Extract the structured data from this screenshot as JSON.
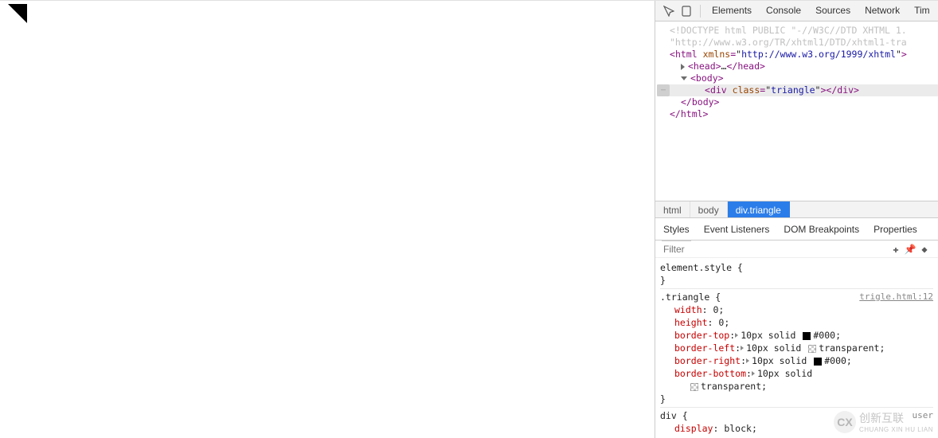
{
  "devtools": {
    "tabs": [
      "Elements",
      "Console",
      "Sources",
      "Network",
      "Tim"
    ],
    "activeTab": 0
  },
  "domTree": {
    "doctype": "<!DOCTYPE html PUBLIC \"-//W3C//DTD XHTML 1.",
    "doctypeUrl": "\"http://www.w3.org/TR/xhtml1/DTD/xhtml1-tra",
    "html": {
      "tag": "html",
      "attrName": "xmlns",
      "attrValue": "http://www.w3.org/1999/xhtml"
    },
    "head": {
      "open": "<head>",
      "ellipsis": "…",
      "close": "</head>"
    },
    "body": {
      "open": "<body>",
      "close": "</body>"
    },
    "div": {
      "tag": "div",
      "attrName": "class",
      "attrValue": "triangle"
    },
    "htmlClose": "</html>"
  },
  "breadcrumb": [
    "html",
    "body",
    "div.triangle"
  ],
  "stylesPane": {
    "tabs": [
      "Styles",
      "Event Listeners",
      "DOM Breakpoints",
      "Properties"
    ],
    "filterPlaceholder": "Filter"
  },
  "rules": {
    "elementStyle": {
      "selector": "element.style {",
      "close": "}"
    },
    "triangle": {
      "selector": ".triangle {",
      "source": "trigle.html:12",
      "decls": [
        {
          "name": "width",
          "value": "0"
        },
        {
          "name": "height",
          "value": "0"
        },
        {
          "name": "border-top",
          "value": "10px solid",
          "swatch": "black",
          "color": "#000"
        },
        {
          "name": "border-left",
          "value": "10px solid",
          "swatch": "trans",
          "color": "transparent"
        },
        {
          "name": "border-right",
          "value": "10px solid",
          "swatch": "black",
          "color": "#000"
        },
        {
          "name": "border-bottom",
          "value": "10px solid",
          "swatch": "trans",
          "color2line": true,
          "color": "transparent"
        }
      ],
      "close": "}"
    },
    "div": {
      "selector": "div {",
      "agent": "user",
      "decls": [
        {
          "name": "display",
          "value": "block"
        }
      ]
    }
  },
  "watermark": {
    "label": "创新互联",
    "sub": "CHUANG XIN HU LIAN"
  }
}
